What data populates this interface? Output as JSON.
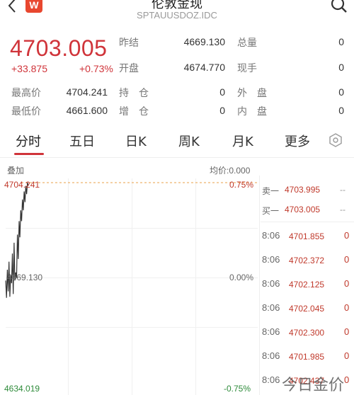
{
  "header": {
    "title": "伦敦金现",
    "subtitle": "SPTAUUSDOZ.IDC",
    "logo": "W"
  },
  "quote": {
    "price": "4703.005",
    "change": "+33.875",
    "change_pct": "+0.73%",
    "prev_close_label": "昨结",
    "prev_close": "4669.130",
    "volume_label": "总量",
    "volume": "0",
    "open_label": "开盘",
    "open": "4674.770",
    "hand_label": "现手",
    "hand": "0",
    "high_label": "最高价",
    "high": "4704.241",
    "oi_label": "持　仓",
    "oi": "0",
    "outer_label": "外　盘",
    "outer": "0",
    "low_label": "最低价",
    "low": "4661.600",
    "oi_add_label": "增　仓",
    "oi_add": "0",
    "inner_label": "内　盘",
    "inner": "0"
  },
  "tabs": [
    "分时",
    "五日",
    "日K",
    "周K",
    "月K",
    "更多"
  ],
  "chart": {
    "overlay_label": "叠加",
    "avg_label": "均价:0.000",
    "top_price": "4704.241",
    "mid_price": "4669.130",
    "bottom_price": "4634.019",
    "top_pct": "0.75%",
    "mid_pct": "0.00%",
    "bottom_pct": "-0.75%"
  },
  "chart_data": {
    "type": "line",
    "ylim": [
      4634.019,
      4704.241
    ],
    "values": [
      4668,
      4661.6,
      4672,
      4664,
      4675,
      4662,
      4670,
      4667,
      4678,
      4663,
      4682,
      4668,
      4671,
      4669,
      4685,
      4676,
      4690,
      4684,
      4694,
      4690,
      4698,
      4694,
      4701,
      4697,
      4703,
      4700,
      4704.241,
      4703.005
    ],
    "ref_line": 4704.241
  },
  "book": {
    "sell_label": "卖一",
    "sell_price": "4703.995",
    "sell_vol": "--",
    "buy_label": "买一",
    "buy_price": "4703.005",
    "buy_vol": "--"
  },
  "trades": [
    {
      "time": "8:06",
      "price": "4701.855",
      "vol": "0"
    },
    {
      "time": "8:06",
      "price": "4702.372",
      "vol": "0"
    },
    {
      "time": "8:06",
      "price": "4702.125",
      "vol": "0"
    },
    {
      "time": "8:06",
      "price": "4702.045",
      "vol": "0"
    },
    {
      "time": "8:06",
      "price": "4702.300",
      "vol": "0"
    },
    {
      "time": "8:06",
      "price": "4701.985",
      "vol": "0"
    },
    {
      "time": "8:06",
      "price": "4702.437",
      "vol": "0"
    }
  ],
  "watermark": "今日金价",
  "colors": {
    "up": "#d0343a",
    "down": "#2e8b3a",
    "accent": "#e8472f"
  }
}
